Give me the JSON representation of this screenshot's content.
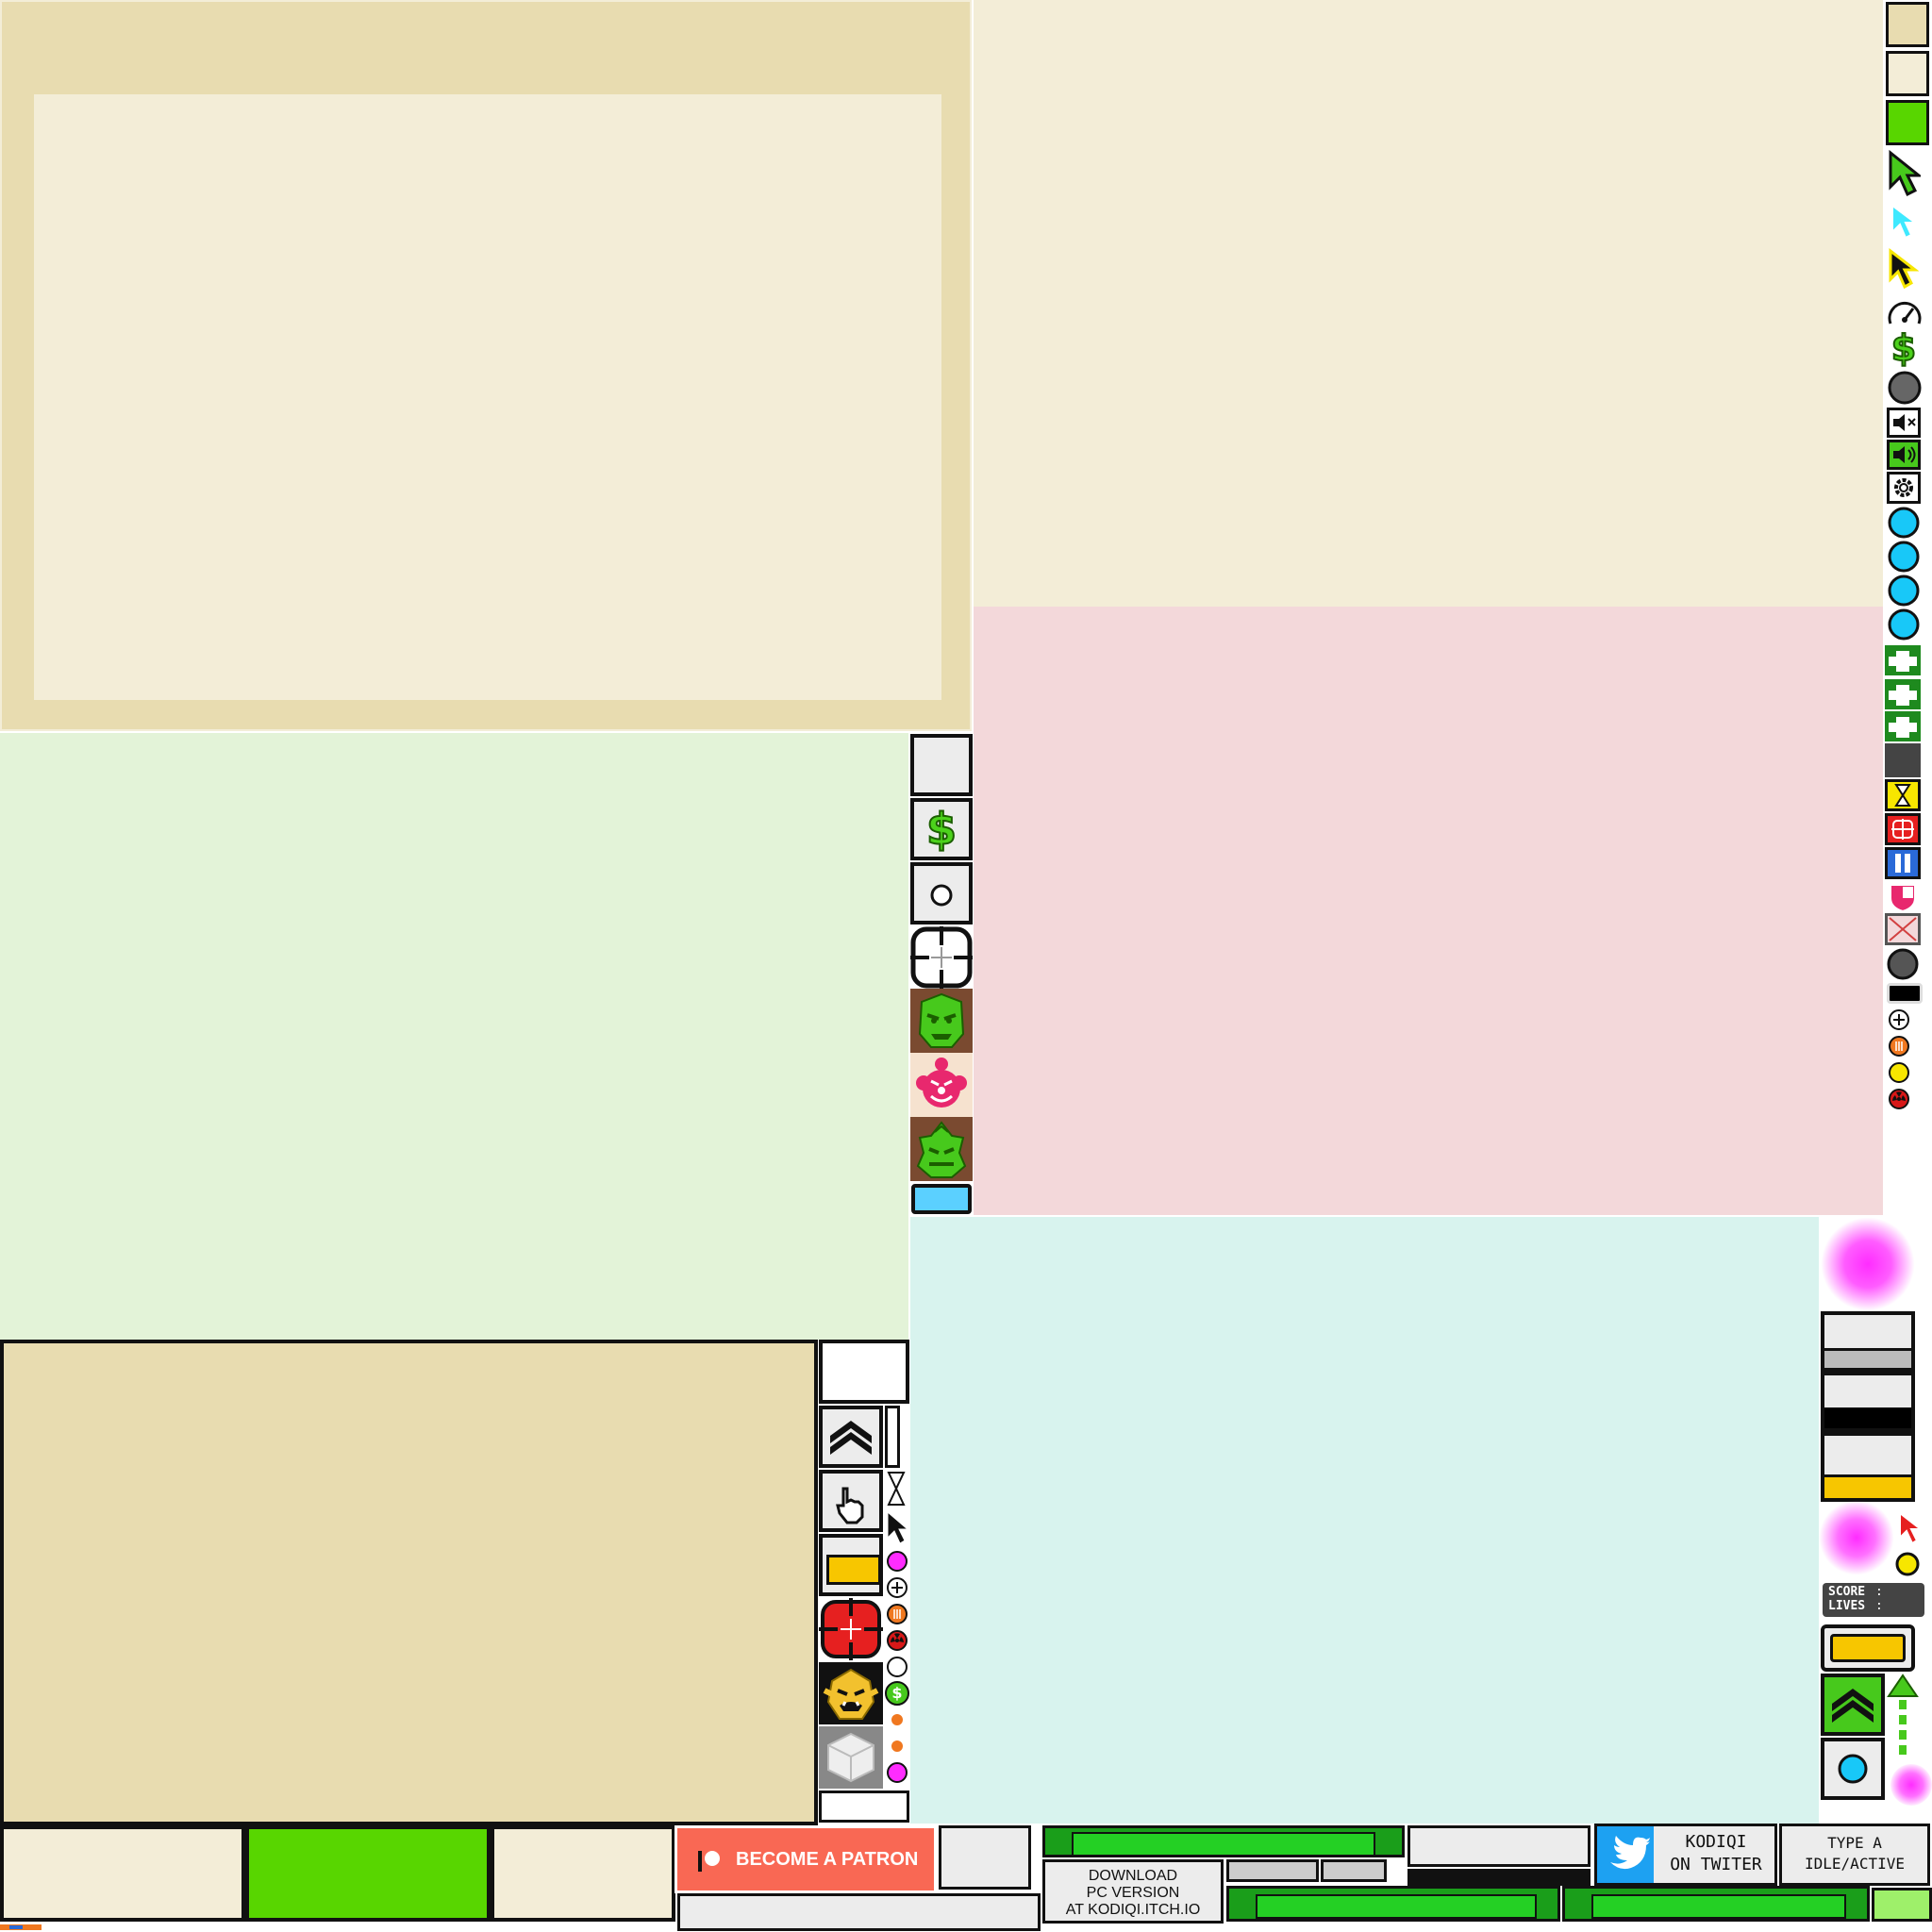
{
  "patreon": {
    "label": "BECOME A PATRON"
  },
  "download": {
    "line1": "DOWNLOAD",
    "line2": "PC  VERSION",
    "line3": "AT  KODIQI.ITCH.IO"
  },
  "twitter": {
    "line1": "KODIQI",
    "line2": "ON TWITER"
  },
  "idle_hint": {
    "line1": "TYPE A",
    "line2": "IDLE/ACTIVE"
  },
  "hud": {
    "score_label": "SCORE",
    "lives_label": "LIVES",
    "score_sep": ":",
    "lives_sep": ":"
  },
  "money_symbol": "$",
  "colors": {
    "parchment": "#f3edd7",
    "parchment_dark": "#e8dcb0",
    "mint": "#e3f3d8",
    "pink": "#f3d8da",
    "aqua": "#d8f3ee",
    "accent_green": "#58d600",
    "patreon_red": "#f96854",
    "twitter_blue": "#1da1f2",
    "gold": "#f7c600",
    "cyan": "#18c8f8"
  },
  "icons": [
    "cursor-green",
    "cursor-cyan",
    "cursor-yellow",
    "speedometer",
    "dollar",
    "orb-gray",
    "mute",
    "volume",
    "gear",
    "orb-cyan",
    "plus-health",
    "hourglass",
    "crosshair",
    "pause",
    "shield",
    "close",
    "plus-circle",
    "ammo",
    "coin",
    "radiation",
    "chevrons-up",
    "hand-pointer",
    "goblin-face",
    "clown-face",
    "monster-face",
    "ogre-face",
    "cube",
    "glow-orb"
  ]
}
